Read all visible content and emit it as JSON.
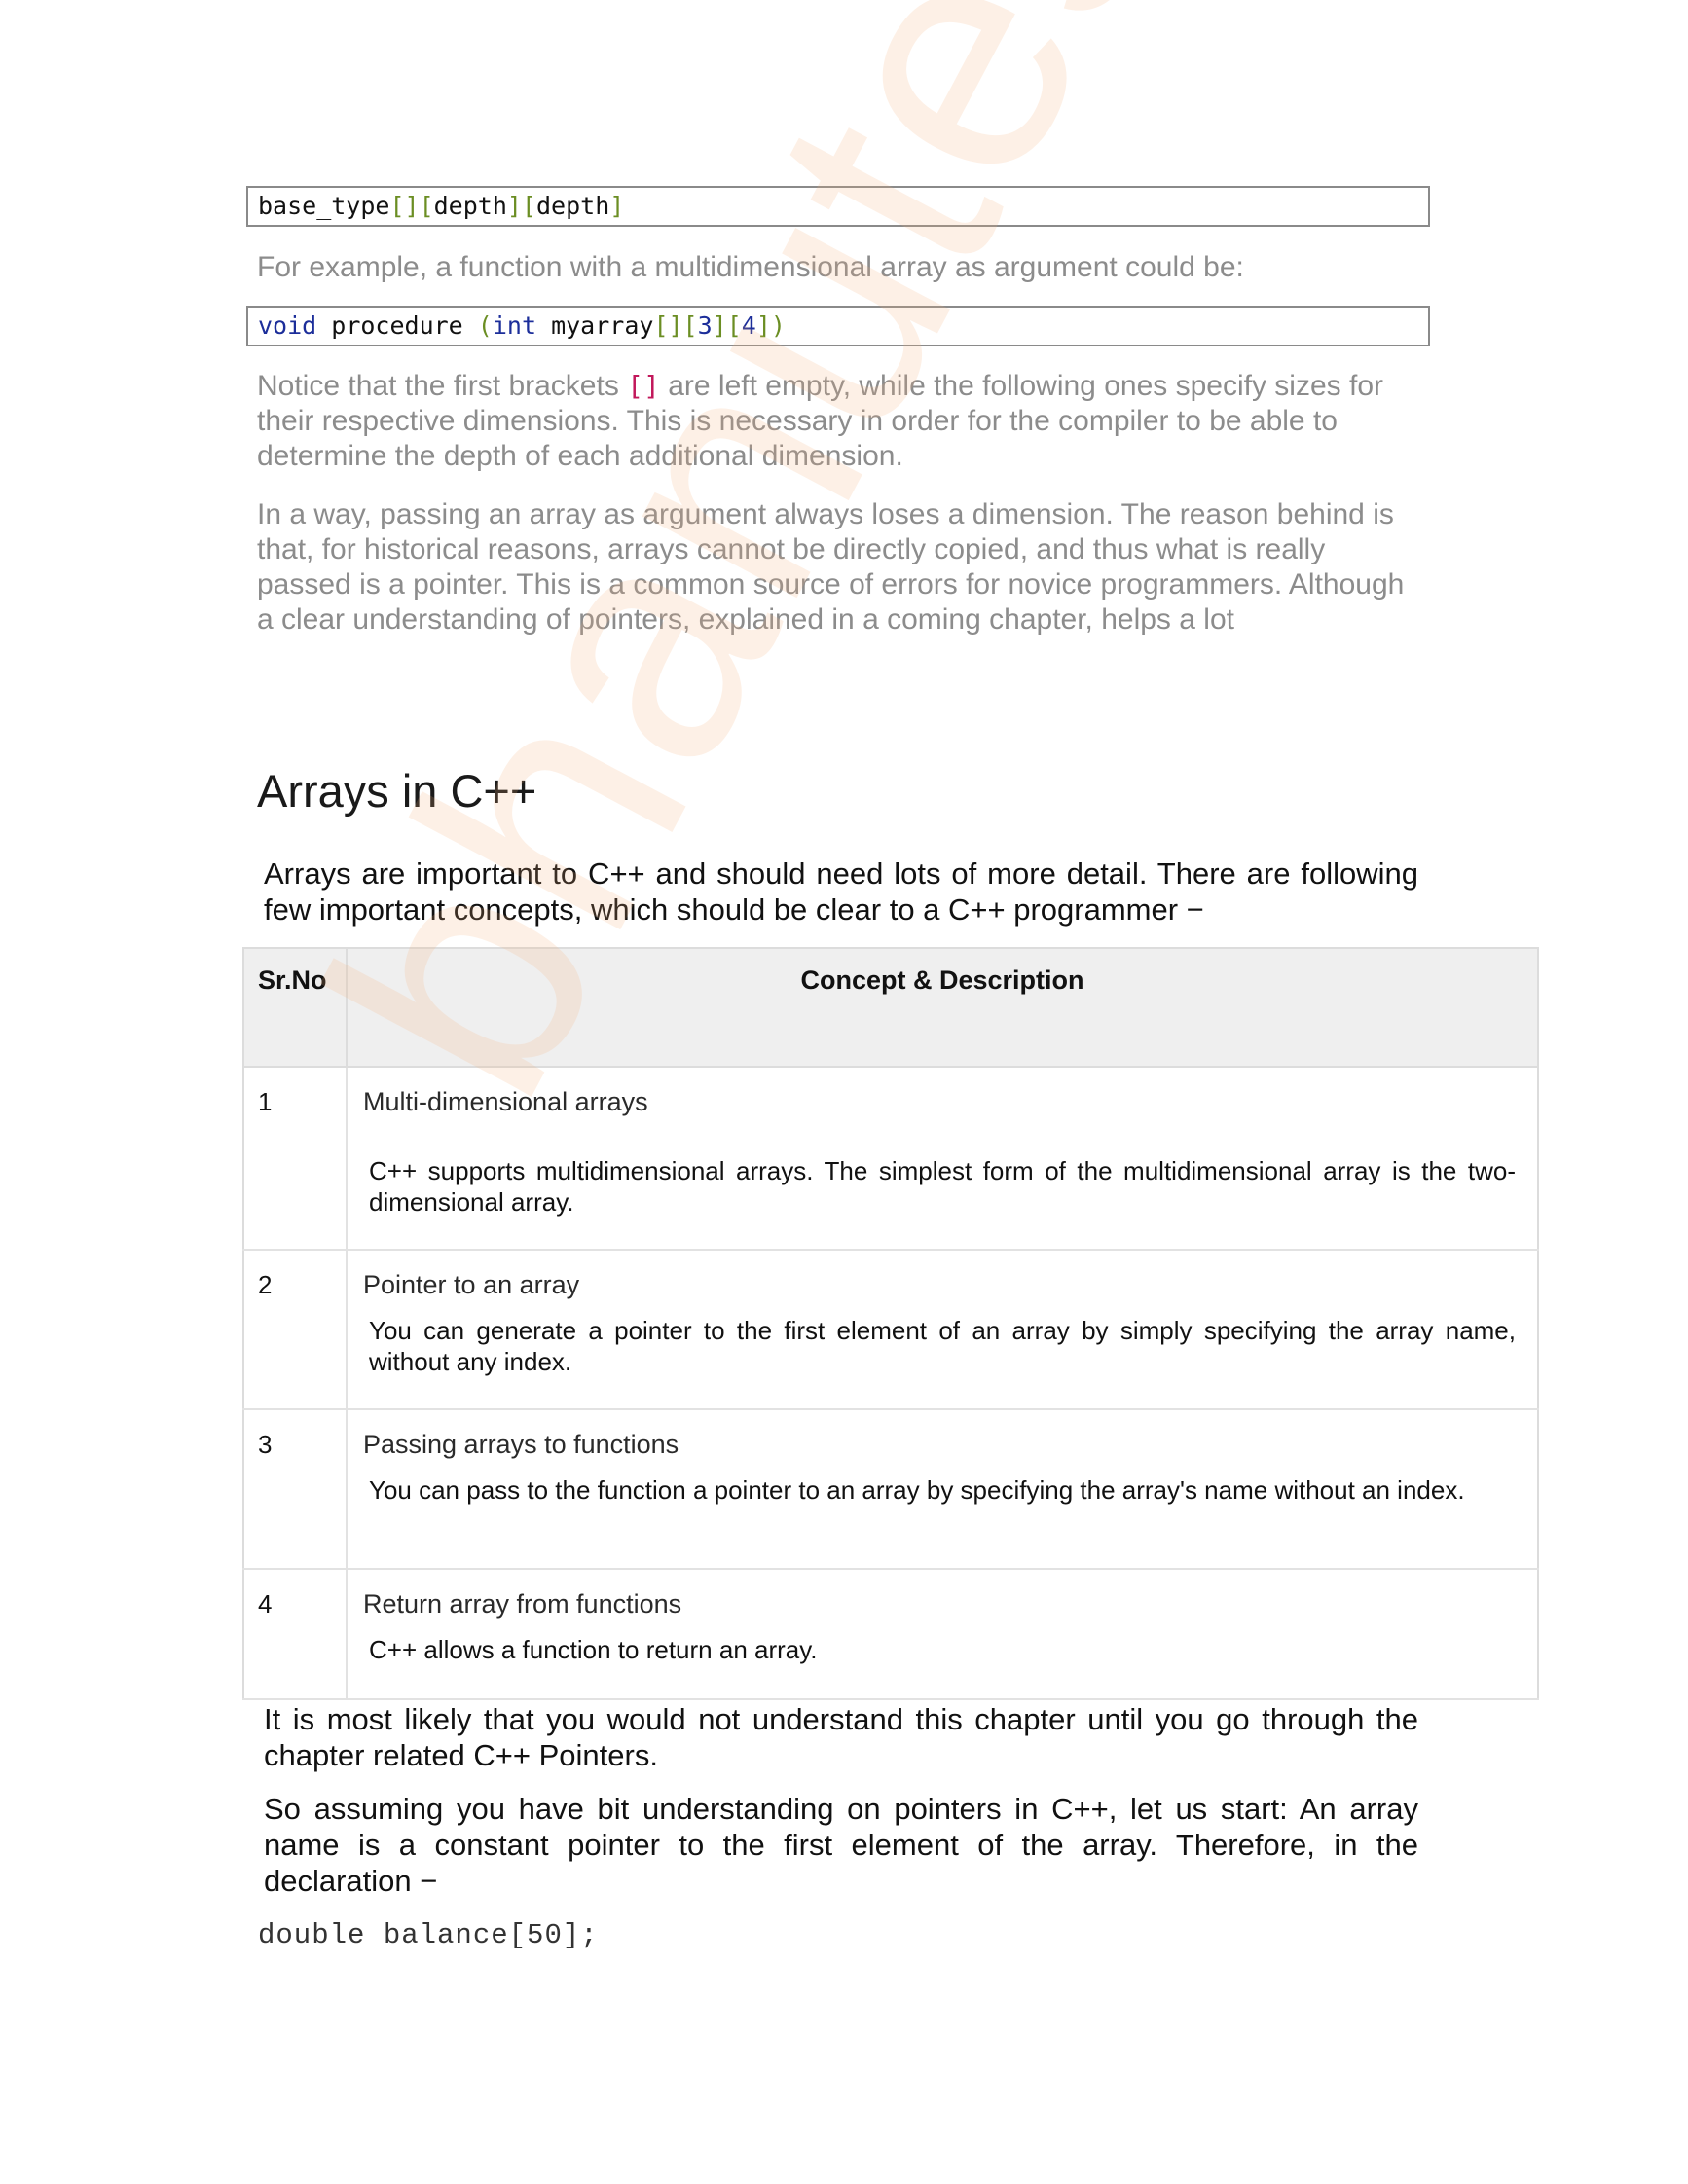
{
  "code_1": "base_type[][depth][depth]",
  "intro_line": "For example, a function with a multidimensional array as argument could be:",
  "code_2": "void procedure (int myarray[][3][4])",
  "notice": {
    "before": "Notice that the first brackets ",
    "bracket": "[]",
    "after": " are left empty, while the following ones specify sizes for their respective dimensions. This is necessary in order for the compiler to be able to determine the depth of each additional dimension."
  },
  "paragraph_loss": "In a way, passing an array as argument always loses a dimension. The reason behind is that, for historical reasons, arrays cannot be directly copied, and thus what is really passed is a pointer. This is a common source of errors for novice programmers. Although a clear understanding of pointers, explained in a coming chapter, helps a lot",
  "heading": "Arrays in C++",
  "intro_paragraph": "Arrays are important to C++ and should need lots of more detail. There are following few important concepts, which should be clear to a C++ programmer −",
  "table": {
    "headers": [
      "Sr.No",
      "Concept & Description"
    ],
    "rows": [
      {
        "no": "1",
        "title": "Multi-dimensional arrays",
        "desc": "C++ supports multidimensional arrays. The simplest form of the multidimensional array is the two-dimensional array."
      },
      {
        "no": "2",
        "title": "Pointer to an array",
        "desc": "You can generate a pointer to the first element of an array by simply specifying the array name, without any index."
      },
      {
        "no": "3",
        "title": "Passing arrays to functions",
        "desc": "You can pass to the function a pointer to an array by specifying the array's name without an index."
      },
      {
        "no": "4",
        "title": "Return array from functions",
        "desc": "C++ allows a function to return an array."
      }
    ]
  },
  "paragraph_likely": "It is most likely that you would not understand this chapter until you go through the chapter related C++ Pointers.",
  "paragraph_assuming": "So assuming you have bit understanding on pointers in C++, let us start: An array name is a constant pointer to the first element of the array. Therefore, in the declaration −",
  "code_3": "double balance[50];",
  "watermark": "bhanutes"
}
